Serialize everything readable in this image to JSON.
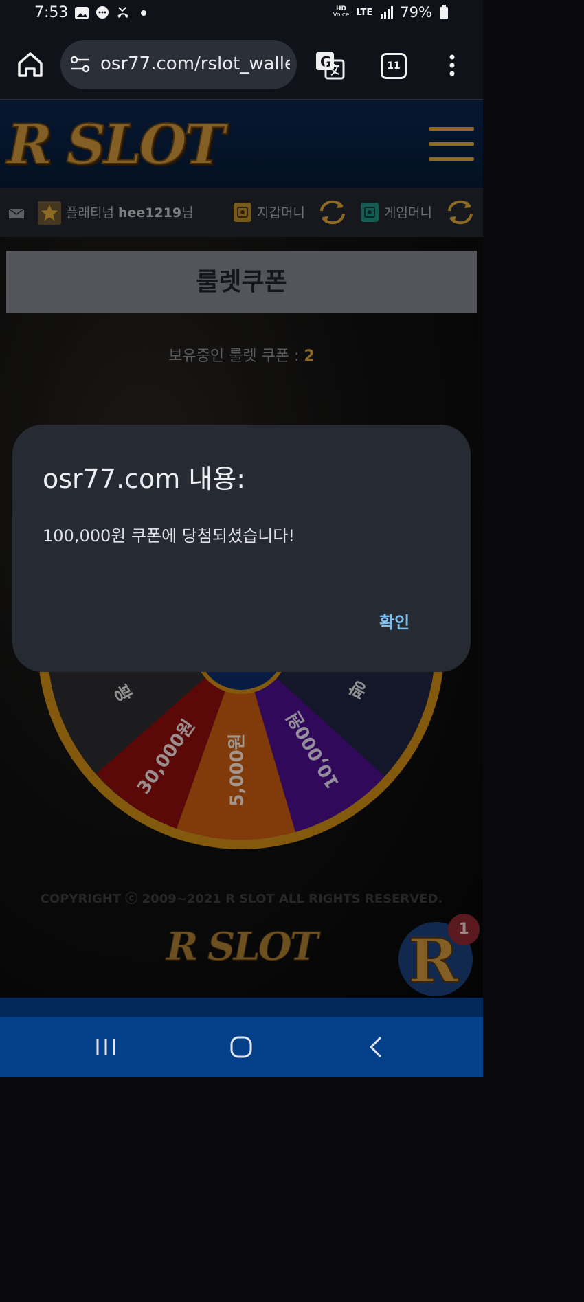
{
  "status_bar": {
    "time": "7:53",
    "network_hd": "HD",
    "network_voice": "Voice",
    "network_type": "LTE",
    "battery": "79%"
  },
  "browser": {
    "url": "osr77.com/rslot_walle",
    "tab_count": "11"
  },
  "site": {
    "logo": "R SLOT"
  },
  "user_bar": {
    "grade": "플래티넘",
    "username": "hee1219",
    "suffix": "님",
    "wallet_label": "지갑머니",
    "game_label": "게임머니"
  },
  "page": {
    "title": "룰렛쿠폰",
    "coupon_label": "보유중인 룰렛 쿠폰 : ",
    "coupon_count": "2"
  },
  "wheel": {
    "segments": [
      "꽝",
      "30,000원",
      "5,000원",
      "10,000원",
      "꽝"
    ]
  },
  "footer": {
    "copyright": "COPYRIGHT ⓒ 2009~2021 R SLOT ALL RIGHTS RESERVED.",
    "logo": "R SLOT",
    "fab_letter": "R",
    "fab_badge": "1"
  },
  "dialog": {
    "title": "osr77.com 내용:",
    "message": "100,000원 쿠폰에 당첨되셨습니다!",
    "confirm": "확인"
  },
  "colors": {
    "accent": "#d9a43a",
    "header": "#0b2448",
    "dialog_bg": "#262a32",
    "confirm": "#7fbff0",
    "navbar": "#04408a"
  }
}
